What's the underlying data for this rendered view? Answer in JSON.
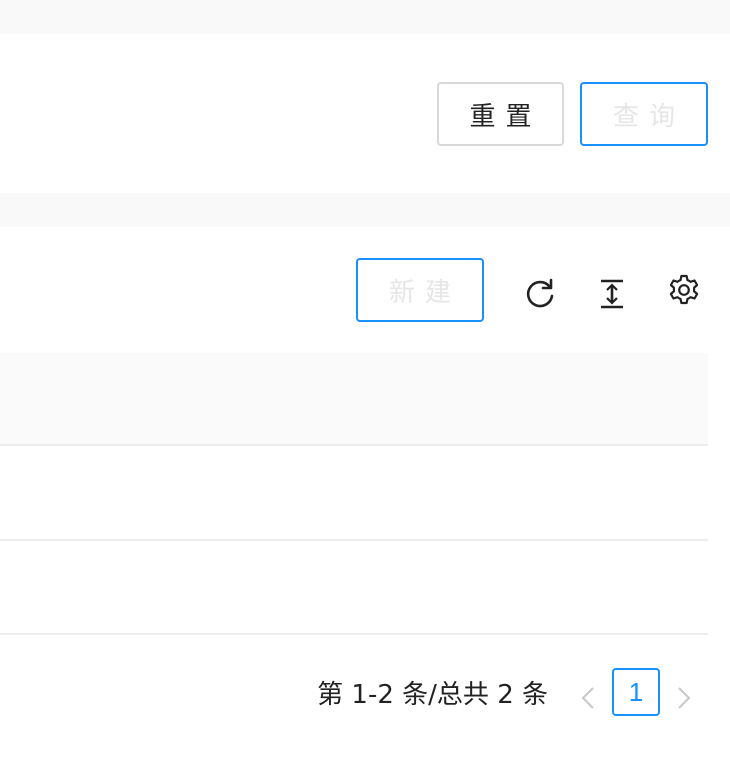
{
  "search_form": {
    "reset_label": "重置",
    "query_label": "查询"
  },
  "toolbar": {
    "new_label": "新建",
    "icons": [
      "reload-icon",
      "column-height-icon",
      "setting-icon"
    ]
  },
  "table": {
    "rows": [
      {},
      {}
    ]
  },
  "pagination": {
    "total_text": "第 1-2 条/总共 2 条",
    "current_page": "1"
  },
  "colors": {
    "primary": "#1890ff",
    "border": "#d9d9d9",
    "header_bg": "#fafafa",
    "band_bg": "#f9f9f9"
  }
}
